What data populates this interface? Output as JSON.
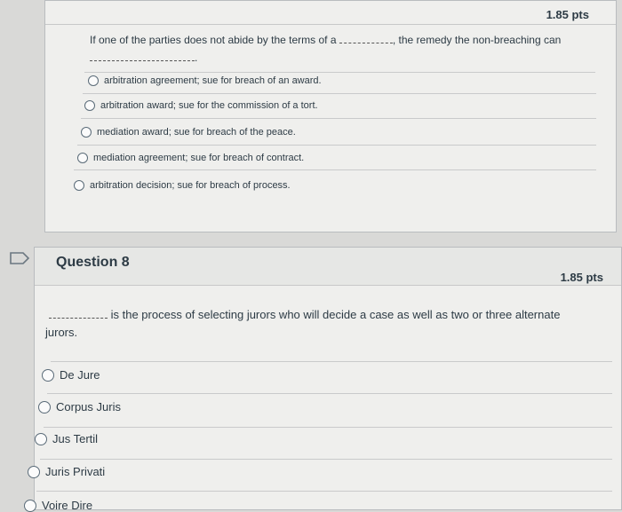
{
  "q7": {
    "points": "1.85 pts",
    "text_before": "If one of the parties does not abide by the terms of a",
    "text_after": ", the remedy the non-breaching can",
    "answers": [
      "arbitration agreement; sue for breach of an award.",
      "arbitration award; sue for the commission of a tort.",
      "mediation award; sue for breach of the peace.",
      "mediation agreement; sue for breach of contract.",
      "arbitration decision; sue for breach of process."
    ]
  },
  "q8": {
    "title": "Question 8",
    "points": "1.85 pts",
    "text": "is the process of selecting jurors who will decide a case as well as two or three alternate",
    "text_cont": "jurors.",
    "answers": [
      "De Jure",
      "Corpus Juris",
      "Jus Tertil",
      "Juris Privati",
      "Voire Dire"
    ]
  }
}
